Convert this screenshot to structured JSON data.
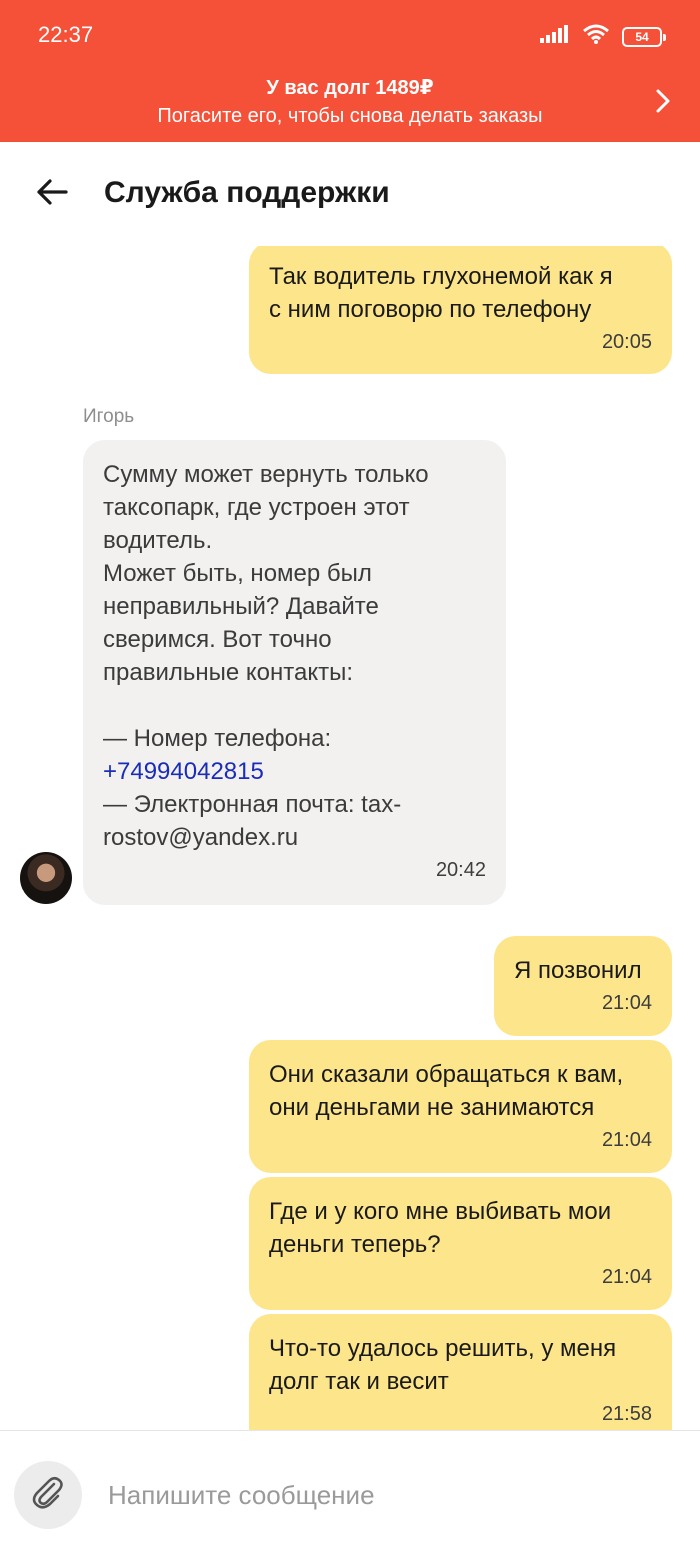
{
  "status_bar": {
    "time": "22:37",
    "battery": "54",
    "icons": [
      "signal-icon",
      "wifi-icon",
      "battery-icon"
    ]
  },
  "banner": {
    "title": "У вас долг 1489₽",
    "subtitle": "Погасите его, чтобы снова делать заказы",
    "color": "#f55139",
    "icon": "chevron-right-icon"
  },
  "header": {
    "title": "Служба поддержки",
    "back_icon": "arrow-left-icon"
  },
  "chat": {
    "sender_name": "Игорь",
    "messages": [
      {
        "direction": "out",
        "text": "Так водитель глухонемой как я\nс ним поговорю по телефону",
        "time": "20:05"
      },
      {
        "direction": "in",
        "text_before": "Сумму может вернуть только\nтаксопарк, где устроен этот\nводитель.\nМожет быть, номер был\nнеправильный? Давайте\nсверимся. Вот точно\nправильные контакты:\n\n— Номер телефона:\n",
        "phone": "+74994042815",
        "text_after": "\n— Электронная почта: tax-\nrostov@yandex.ru",
        "time": "20:42"
      },
      {
        "direction": "out",
        "text": "Я позвонил",
        "time": "21:04"
      },
      {
        "direction": "out",
        "text": "Они сказали обращаться к вам,\nони деньгами не занимаются",
        "time": "21:04"
      },
      {
        "direction": "out",
        "text": "Где и у кого мне выбивать мои\nденьги теперь?",
        "time": "21:04"
      },
      {
        "direction": "out",
        "text": "Что-то удалось решить, у меня\nдолг так и весит",
        "time": "21:58"
      }
    ],
    "colors": {
      "outgoing": "#fce58a",
      "incoming": "#f2f1ef",
      "link": "#1a2db8"
    }
  },
  "composer": {
    "placeholder": "Напишите сообщение",
    "value": "",
    "attach_icon": "paperclip-icon"
  }
}
